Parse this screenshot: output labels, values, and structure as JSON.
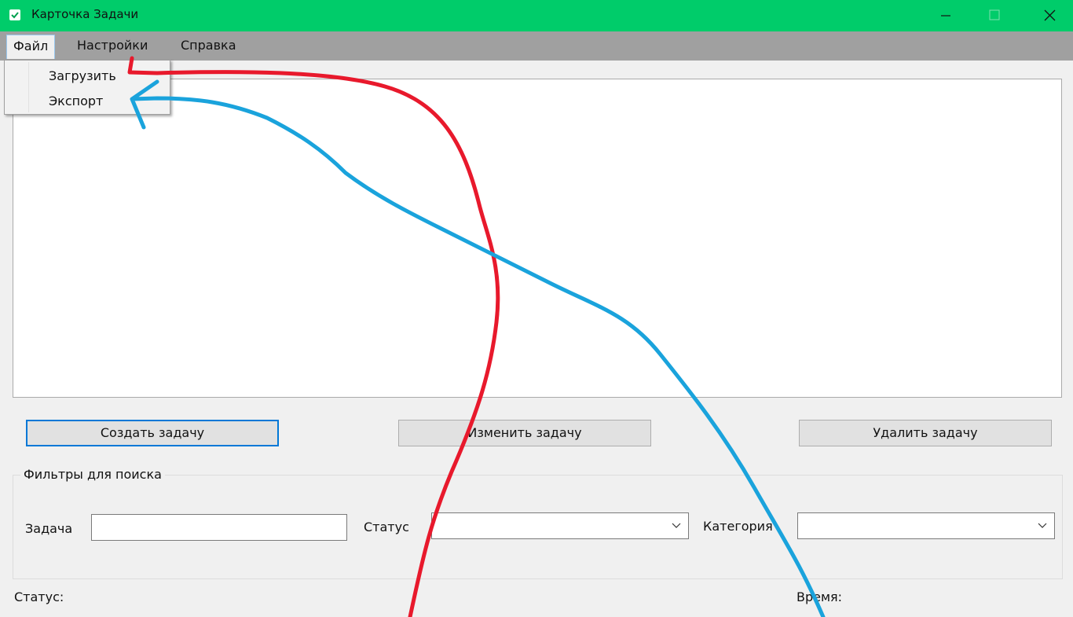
{
  "window": {
    "title": "Карточка Задачи"
  },
  "menu": {
    "file": "Файл",
    "settings": "Настройки",
    "help": "Справка"
  },
  "file_menu": {
    "items": [
      "Загрузить",
      "Экспорт"
    ]
  },
  "buttons": {
    "create": "Создать задачу",
    "edit": "Изменить задачу",
    "delete": "Удалить задачу"
  },
  "filters": {
    "legend": "Фильтры для поиска",
    "task_label": "Задача",
    "task_value": "",
    "status_label": "Статус",
    "status_value": "",
    "category_label": "Категория",
    "category_value": ""
  },
  "statusbar": {
    "status_label": "Статус:",
    "time_label": "Время:"
  },
  "colors": {
    "titlebar": "#00cc6a",
    "menubar": "#a0a0a0",
    "accent": "#0078d7",
    "annotation_red": "#e8192c",
    "annotation_blue": "#1aa3dc"
  },
  "icons": {
    "app": "checkbox-icon",
    "minimize": "minimize-icon",
    "maximize": "maximize-icon",
    "close": "close-icon",
    "dropdown": "chevron-down-icon"
  }
}
